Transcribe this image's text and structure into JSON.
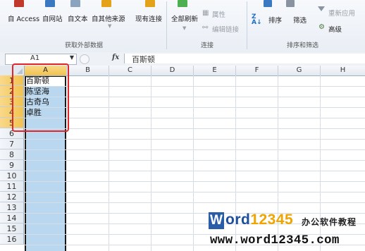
{
  "ribbon": {
    "get_external": {
      "buttons": [
        "自 Access",
        "自网站",
        "自文本",
        "自其他来源"
      ],
      "label": "获取外部数据"
    },
    "existing_connections": "现有连接",
    "connections": {
      "refresh_all": "全部刷新",
      "properties": "属性",
      "edit_links": "编辑链接",
      "label": "连接"
    },
    "sort_filter": {
      "sort": "排序",
      "filter": "筛选",
      "reapply": "重新应用",
      "advanced": "高级",
      "label": "排序和筛选"
    },
    "colors": {
      "accent": "#1f6fc8",
      "border": "#b8c6d6"
    }
  },
  "formula_bar": {
    "name_box": "A1",
    "fx": "fx",
    "content": "百斯顿"
  },
  "sheet": {
    "columns": [
      "A",
      "B",
      "C",
      "D",
      "E",
      "F",
      "G",
      "H"
    ],
    "rows": [
      "1",
      "2",
      "3",
      "4",
      "5",
      "6",
      "7",
      "8",
      "9",
      "10",
      "11",
      "12",
      "13",
      "14",
      "15",
      "16"
    ],
    "cells": [
      {
        "ref": "A1",
        "value": "百斯顿"
      },
      {
        "ref": "A2",
        "value": "陈坚海"
      },
      {
        "ref": "A3",
        "value": "古奇乌"
      },
      {
        "ref": "A4",
        "value": "卓胜"
      }
    ],
    "selected_column": "A",
    "highlight_color": "#e0262a"
  },
  "watermark": {
    "logo_w": "W",
    "logo_ord": "ord",
    "logo_num": "12345",
    "tagline": "办公软件教程",
    "url": "www.word12345.com"
  }
}
